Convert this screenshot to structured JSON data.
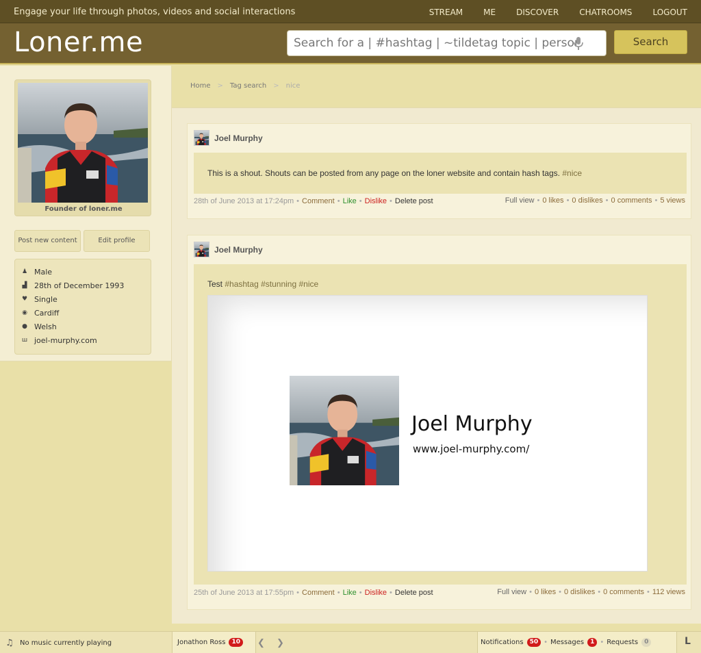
{
  "topbar": {
    "tagline": "Engage your life through photos, videos and social interactions",
    "nav": [
      "STREAM",
      "ME",
      "DISCOVER",
      "CHATROOMS",
      "LOGOUT"
    ]
  },
  "header": {
    "logo": "Loner.me",
    "search_placeholder": "Search for a | #hashtag | ~tildetag topic | person...",
    "search_button": "Search"
  },
  "profile": {
    "caption": "Founder of loner.me",
    "post_new_content": "Post new content",
    "edit_profile": "Edit profile",
    "info": [
      {
        "icon": "gender-icon",
        "text": "Male"
      },
      {
        "icon": "birthday-icon",
        "text": "28th of December 1993"
      },
      {
        "icon": "heart-icon",
        "text": "Single"
      },
      {
        "icon": "location-pin-icon",
        "text": "Cardiff"
      },
      {
        "icon": "globe-icon",
        "text": "Welsh"
      },
      {
        "icon": "website-icon",
        "text": "joel-murphy.com"
      }
    ]
  },
  "breadcrumb": {
    "items": [
      "Home",
      "Tag search",
      "nice"
    ],
    "separator": ">"
  },
  "posts": [
    {
      "author": "Joel Murphy",
      "text": "This is a shout. Shouts can be posted from any page on the loner website and contain hash tags.",
      "hashtags": [
        "#nice"
      ],
      "date": "28th of June 2013 at 17:24pm",
      "actions": {
        "comment": "Comment",
        "like": "Like",
        "dislike": "Dislike",
        "delete": "Delete post"
      },
      "stats": {
        "full_view": "Full view",
        "likes": "0 likes",
        "dislikes": "0 dislikes",
        "comments": "0 comments",
        "views": "5 views"
      }
    },
    {
      "author": "Joel Murphy",
      "text": "Test",
      "hashtags": [
        "#hashtag",
        "#stunning",
        "#nice"
      ],
      "embed": {
        "name": "Joel Murphy",
        "url": "www.joel-murphy.com/"
      },
      "date": "25th of June 2013 at 17:55pm",
      "actions": {
        "comment": "Comment",
        "like": "Like",
        "dislike": "Dislike",
        "delete": "Delete post"
      },
      "stats": {
        "full_view": "Full view",
        "likes": "0 likes",
        "dislikes": "0 dislikes",
        "comments": "0 comments",
        "views": "112 views"
      }
    }
  ],
  "bottombar": {
    "music": "No music currently playing",
    "chat_user": "Jonathon Ross",
    "chat_count": "10",
    "notifications_label": "Notifications",
    "notifications_count": "50",
    "messages_label": "Messages",
    "messages_count": "1",
    "requests_label": "Requests",
    "requests_count": "0",
    "corner_glyph": "L"
  },
  "colors": {
    "topbar": "#5e4f24",
    "header": "#746131",
    "accent": "#d6c35c",
    "page_bg": "#e9e0a8",
    "badge": "#d11b1b"
  }
}
